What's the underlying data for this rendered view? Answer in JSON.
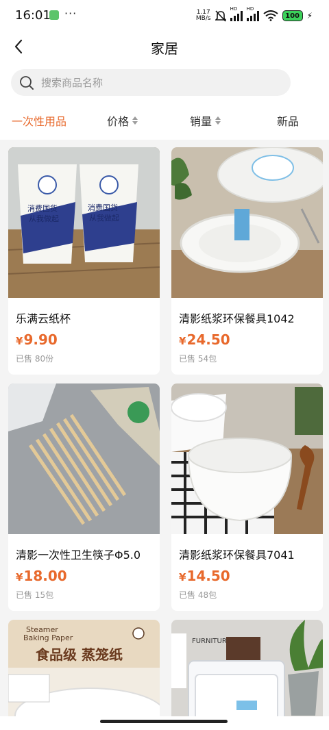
{
  "status_bar": {
    "time": "16:01",
    "net_speed_value": "1.17",
    "net_speed_unit": "MB/s",
    "battery": "100",
    "hd_label": "HD"
  },
  "nav": {
    "title": "家居"
  },
  "search": {
    "placeholder": "搜索商品名称",
    "value": ""
  },
  "filters": [
    {
      "label": "一次性用品",
      "active": true
    },
    {
      "label": "价格",
      "sortable": true
    },
    {
      "label": "销量",
      "sortable": true
    },
    {
      "label": "新品"
    }
  ],
  "products": [
    {
      "name": "乐满云纸杯",
      "currency": "¥",
      "price": "9.90",
      "sold": "已售 80份"
    },
    {
      "name": "清影纸浆环保餐具1042",
      "currency": "¥",
      "price": "24.50",
      "sold": "已售 54包"
    },
    {
      "name": "清影一次性卫生筷子Φ5.0",
      "currency": "¥",
      "price": "18.00",
      "sold": "已售 15包"
    },
    {
      "name": "清影纸浆环保餐具7041",
      "currency": "¥",
      "price": "14.50",
      "sold": "已售 48包"
    },
    {
      "name": "",
      "currency": "",
      "price": "",
      "sold": ""
    },
    {
      "name": "",
      "currency": "",
      "price": "",
      "sold": ""
    }
  ],
  "product_images": {
    "cup_text_1": "消费国货",
    "cup_text_2": "从我做起",
    "steamer_brand_1": "Steamer",
    "steamer_brand_2": "Baking Paper",
    "steamer_title": "食品级 蒸笼纸",
    "box_sign": "FURNITURE"
  },
  "colors": {
    "accent": "#e8692c",
    "price": "#e8692c",
    "background": "#f4f4f4"
  }
}
